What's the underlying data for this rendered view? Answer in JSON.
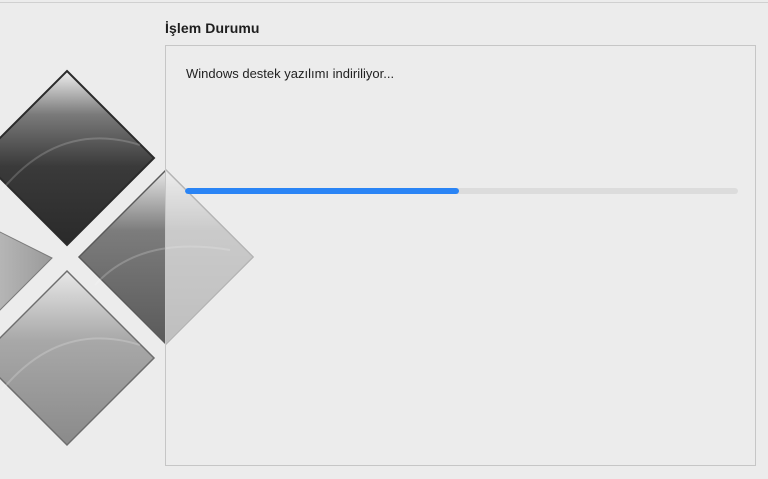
{
  "status_section": {
    "title": "İşlem Durumu",
    "message": "Windows destek yazılımı indiriliyor...",
    "progress_fraction": 0.495
  },
  "colors": {
    "window_background": "#ececec",
    "progress_fill": "#2a84f5",
    "progress_track": "#dcdcdc",
    "panel_border": "#c6c6c6"
  },
  "icons": {
    "logo": "boot-camp-logo-icon"
  }
}
